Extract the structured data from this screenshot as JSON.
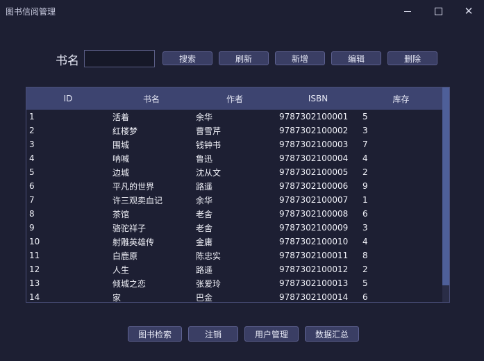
{
  "window": {
    "title": "图书信阅管理"
  },
  "search": {
    "label": "书名",
    "value": "",
    "placeholder": ""
  },
  "toolbar": [
    "搜索",
    "刷新",
    "新增",
    "编辑",
    "删除"
  ],
  "table": {
    "columns": [
      "ID",
      "书名",
      "作者",
      "ISBN",
      "库存"
    ],
    "rows": [
      [
        "1",
        "活着",
        "余华",
        "9787302100001",
        "5"
      ],
      [
        "2",
        "红楼梦",
        "曹雪芹",
        "9787302100002",
        "3"
      ],
      [
        "3",
        "围城",
        "钱钟书",
        "9787302100003",
        "7"
      ],
      [
        "4",
        "呐喊",
        "鲁迅",
        "9787302100004",
        "4"
      ],
      [
        "5",
        "边城",
        "沈从文",
        "9787302100005",
        "2"
      ],
      [
        "6",
        "平凡的世界",
        "路遥",
        "9787302100006",
        "9"
      ],
      [
        "7",
        "许三观卖血记",
        "余华",
        "9787302100007",
        "1"
      ],
      [
        "8",
        "茶馆",
        "老舍",
        "9787302100008",
        "6"
      ],
      [
        "9",
        "骆驼祥子",
        "老舍",
        "9787302100009",
        "3"
      ],
      [
        "10",
        "射雕英雄传",
        "金庸",
        "9787302100010",
        "4"
      ],
      [
        "11",
        "白鹿原",
        "陈忠实",
        "9787302100011",
        "8"
      ],
      [
        "12",
        "人生",
        "路遥",
        "9787302100012",
        "2"
      ],
      [
        "13",
        "倾城之恋",
        "张爱玲",
        "9787302100013",
        "5"
      ],
      [
        "14",
        "家",
        "巴金",
        "9787302100014",
        "6"
      ]
    ]
  },
  "bottom_nav": [
    "图书检索",
    "注销",
    "用户管理",
    "数据汇总"
  ],
  "colors": {
    "background": "#1d1f33",
    "header": "#3d4470",
    "button": "#3a3e64",
    "scroll_thumb": "#4e5f99"
  },
  "icons": {
    "minimize": "minimize-icon",
    "maximize": "maximize-icon",
    "close": "close-icon"
  }
}
